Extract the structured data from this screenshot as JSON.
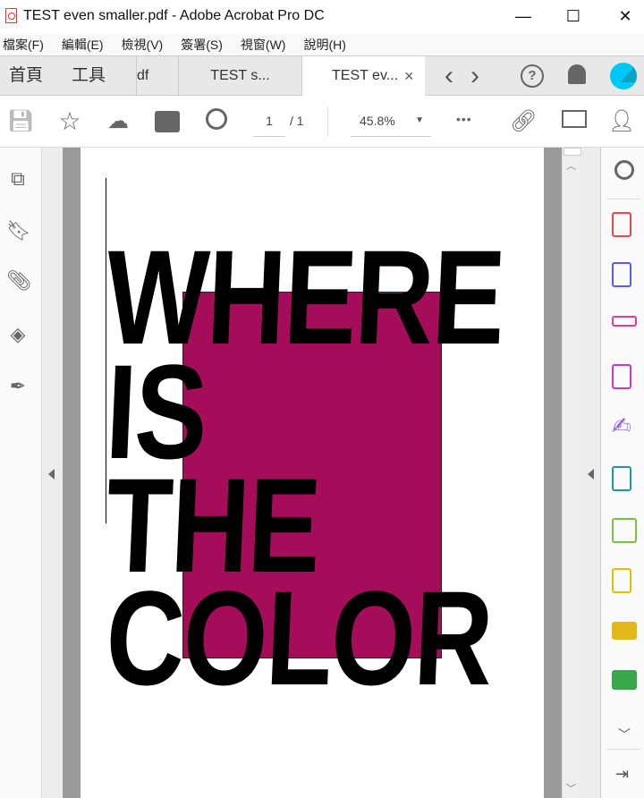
{
  "window": {
    "title": "TEST even smaller.pdf - Adobe Acrobat Pro DC",
    "minimize": "—",
    "maximize": "☐",
    "close": "✕"
  },
  "menu": [
    "檔案(F)",
    "編輯(E)",
    "檢視(V)",
    "簽署(S)",
    "視窗(W)",
    "說明(H)"
  ],
  "tabs": {
    "home": "首頁",
    "tools": "工具",
    "doc1": "df",
    "doc2": "TEST s...",
    "doc3": "TEST ev...",
    "close": "×",
    "prev": "‹",
    "next": "›"
  },
  "toolbar": {
    "page_current": "1",
    "page_total": "/ 1",
    "zoom": "45.8%",
    "more": "•••"
  },
  "document": {
    "lines": [
      "WHERE",
      "IS",
      "THE",
      "COLOR"
    ],
    "block_color": "#a50d5a"
  },
  "colors": {
    "avatar": "#00c8f4"
  }
}
